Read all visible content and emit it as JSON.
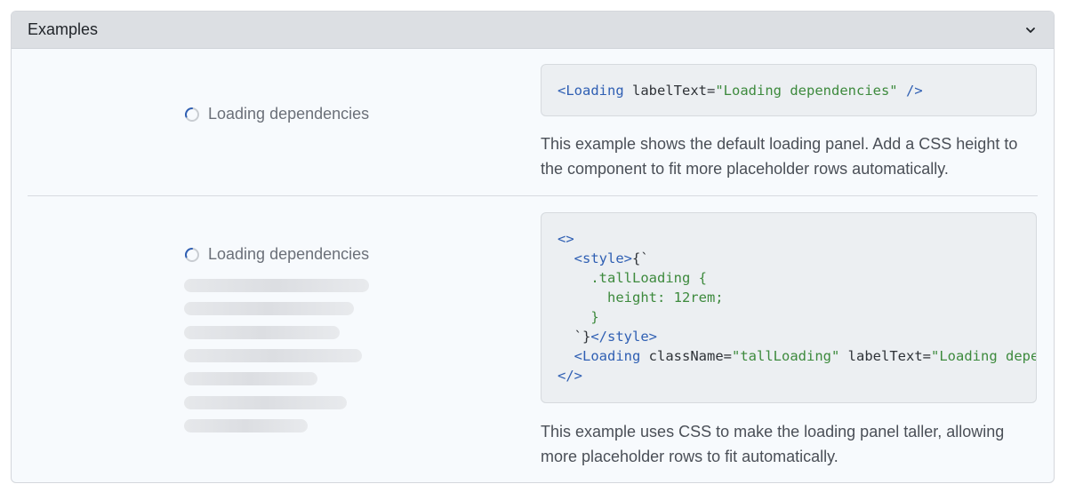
{
  "panel": {
    "title": "Examples",
    "toggle_icon": "chevron-down-icon"
  },
  "examples": [
    {
      "loading_label": "Loading dependencies",
      "code_lines": [
        [
          [
            "tag",
            "<Loading "
          ],
          [
            "attr",
            "labelText"
          ],
          [
            "punc",
            "="
          ],
          [
            "str",
            "\"Loading dependencies\""
          ],
          [
            "tag",
            " />"
          ]
        ]
      ],
      "description": "This example shows the default loading panel. Add a CSS height to the component to fit more placeholder rows automatically."
    },
    {
      "loading_label": "Loading dependencies",
      "skeleton_rows": [
        1.0,
        0.92,
        0.84,
        0.96,
        0.72,
        0.88,
        0.67
      ],
      "code_lines": [
        [
          [
            "tag",
            "<>"
          ]
        ],
        [
          [
            "punc",
            "  "
          ],
          [
            "tag",
            "<style>"
          ],
          [
            "punc",
            "{`"
          ]
        ],
        [
          [
            "str",
            "    .tallLoading {"
          ]
        ],
        [
          [
            "str",
            "      height: 12rem;"
          ]
        ],
        [
          [
            "str",
            "    }"
          ]
        ],
        [
          [
            "punc",
            "  `}"
          ],
          [
            "tag",
            "</style>"
          ]
        ],
        [
          [
            "punc",
            "  "
          ],
          [
            "tag",
            "<Loading "
          ],
          [
            "attr",
            "className"
          ],
          [
            "punc",
            "="
          ],
          [
            "str",
            "\"tallLoading\""
          ],
          [
            "attr",
            " labelText"
          ],
          [
            "punc",
            "="
          ],
          [
            "str",
            "\"Loading depende"
          ]
        ],
        [
          [
            "tag",
            "</>"
          ]
        ]
      ],
      "description": "This example uses CSS to make the loading panel taller, allowing more placeholder rows to fit automatically."
    }
  ]
}
